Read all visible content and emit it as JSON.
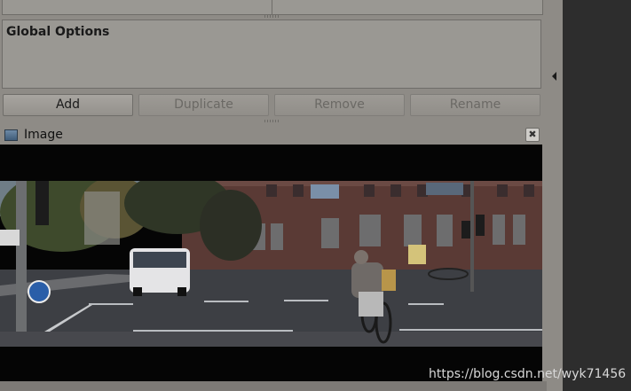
{
  "global_options": {
    "title": "Global Options"
  },
  "buttons": {
    "add": "Add",
    "duplicate": "Duplicate",
    "remove": "Remove",
    "rename": "Rename"
  },
  "image_panel": {
    "title": "Image",
    "close_symbol": "✖"
  },
  "watermark": "https://blog.csdn.net/wyk71456",
  "icons": {
    "image_panel": "image-window-icon",
    "close": "close-icon",
    "collapse": "triangle-left-icon"
  }
}
